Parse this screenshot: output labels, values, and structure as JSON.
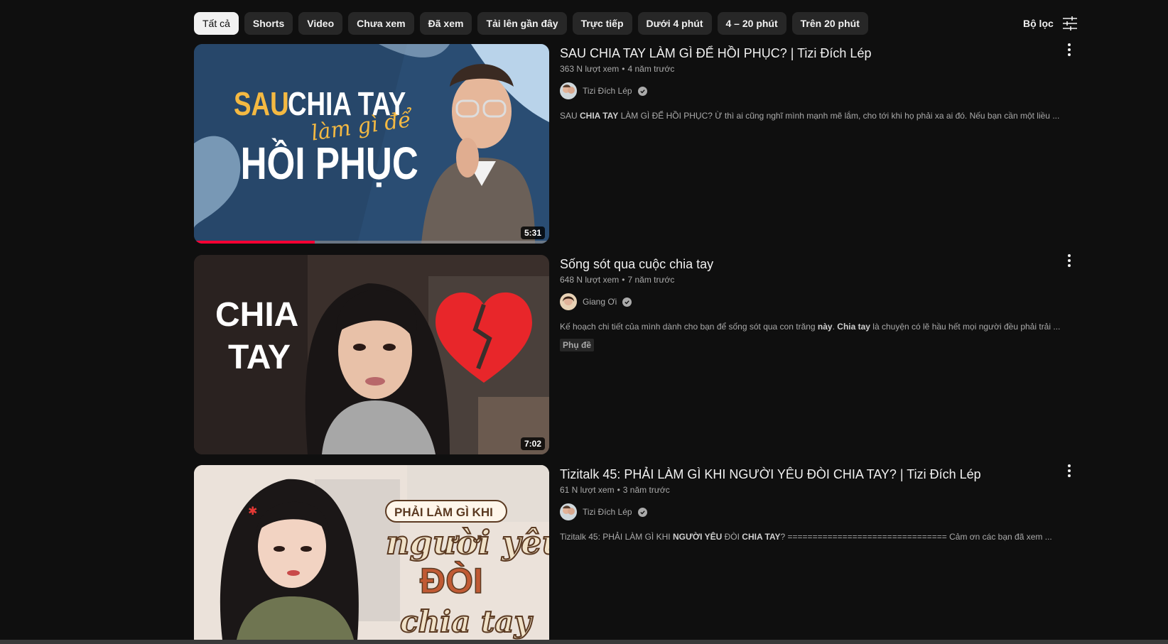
{
  "chips": [
    "Tất cả",
    "Shorts",
    "Video",
    "Chưa xem",
    "Đã xem",
    "Tải lên gần đây",
    "Trực tiếp",
    "Dưới 4 phút",
    "4 – 20 phút",
    "Trên 20 phút"
  ],
  "filter_label": "Bộ lọc",
  "results": [
    {
      "title": "SAU CHIA TAY LÀM GÌ ĐỂ HỒI PHỤC? | Tizi Đích Lép",
      "views": "363 N lượt xem",
      "age": "4 năm trước",
      "channel": "Tizi Đích Lép",
      "desc_parts": [
        {
          "t": "SAU ",
          "b": false
        },
        {
          "t": "CHIA TAY",
          "b": true
        },
        {
          "t": " LÀM GÌ ĐỂ HỒI PHỤC? Ừ thì ai cũng nghĩ mình mạnh mẽ lắm, cho tới khi họ phải xa ai đó. Nếu bạn cần một liều ...",
          "b": false
        }
      ],
      "duration": "5:31",
      "watch_progress": 0.34,
      "thumb_text": [
        "SAU",
        "CHIA TAY",
        "làm gì để",
        "HỒI PHỤC"
      ]
    },
    {
      "title": "Sống sót qua cuộc chia tay",
      "views": "648 N lượt xem",
      "age": "7 năm trước",
      "channel": "Giang Ơi",
      "desc_parts": [
        {
          "t": "Kế hoạch chi tiết của mình dành cho bạn để sống sót qua con trăng ",
          "b": false
        },
        {
          "t": "này",
          "b": true
        },
        {
          "t": ". ",
          "b": false
        },
        {
          "t": "Chia tay",
          "b": true
        },
        {
          "t": " là chuyện có lẽ hầu hết mọi người đều phải trải ...",
          "b": false
        }
      ],
      "badge": "Phụ đề",
      "duration": "7:02",
      "thumb_text": [
        "CHIA",
        "TAY"
      ]
    },
    {
      "title": "Tizitalk 45: PHẢI LÀM GÌ KHI NGƯỜI YÊU ĐÒI CHIA TAY? | Tizi Đích Lép",
      "views": "61 N lượt xem",
      "age": "3 năm trước",
      "channel": "Tizi Đích Lép",
      "desc_parts": [
        {
          "t": "Tizitalk 45: PHẢI LÀM GÌ KHI ",
          "b": false
        },
        {
          "t": "NGƯỜI YÊU",
          "b": true
        },
        {
          "t": " ĐÒI ",
          "b": false
        },
        {
          "t": "CHIA TAY",
          "b": true
        },
        {
          "t": "? ================================ Cảm ơn các bạn đã xem ...",
          "b": false
        }
      ],
      "thumb_text": [
        "PHẢI LÀM GÌ KHI",
        "người yêu",
        "ĐÒI",
        "chia tay"
      ]
    }
  ],
  "colors": {
    "background": "#0f0f0f",
    "chip": "#272727",
    "chip_active": "#f1f1f1",
    "progress": "#ff0033"
  },
  "icons": {
    "filter": "sliders-icon",
    "more": "three-dots-vertical-icon",
    "verified": "check-circle-icon"
  }
}
